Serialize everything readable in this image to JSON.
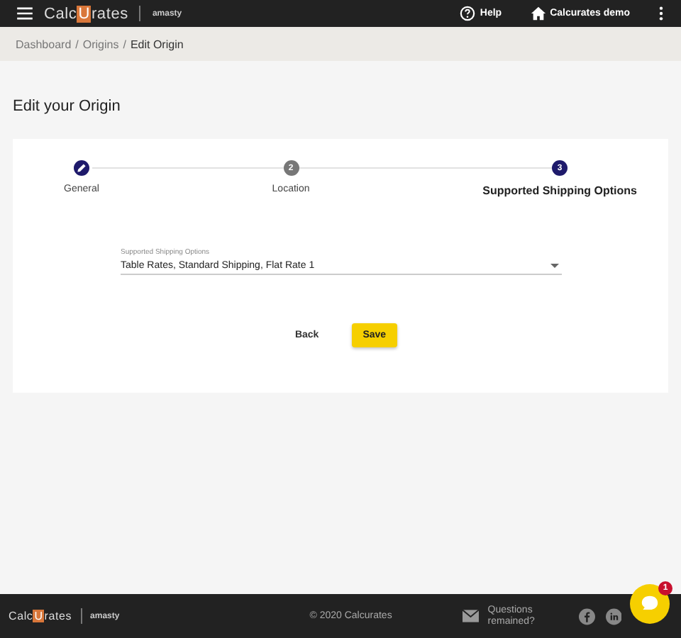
{
  "header": {
    "logo": {
      "before": "Calc",
      "mark": "U",
      "after": "rates"
    },
    "partner": "amasty",
    "help": "Help",
    "account": "Calcurates demo"
  },
  "breadcrumbs": [
    {
      "label": "Dashboard",
      "current": false
    },
    {
      "separator": "/",
      "label": "Origins",
      "current": false
    },
    {
      "separator": "/",
      "label": "Edit Origin",
      "current": true
    }
  ],
  "title": "Edit your Origin",
  "steps": [
    {
      "label": "General",
      "kind": "done",
      "selected": false
    },
    {
      "label": "Location",
      "kind": "pending",
      "number": "2",
      "selected": false
    },
    {
      "label": "Supported Shipping Options",
      "kind": "active",
      "number": "3",
      "selected": true
    }
  ],
  "field": {
    "label": "Supported Shipping Options",
    "value": "Table Rates, Standard Shipping, Flat Rate 1"
  },
  "buttons": [
    {
      "label": "Back",
      "kind": "text"
    },
    {
      "label": "Save",
      "kind": "primary"
    }
  ],
  "footer": {
    "logo": {
      "before": "Calc",
      "mark": "U",
      "after": "rates"
    },
    "partner": "amasty",
    "copyright": "© 2020 Calcurates",
    "questions": "Questions remained?"
  },
  "chat": {
    "badge": "1"
  }
}
